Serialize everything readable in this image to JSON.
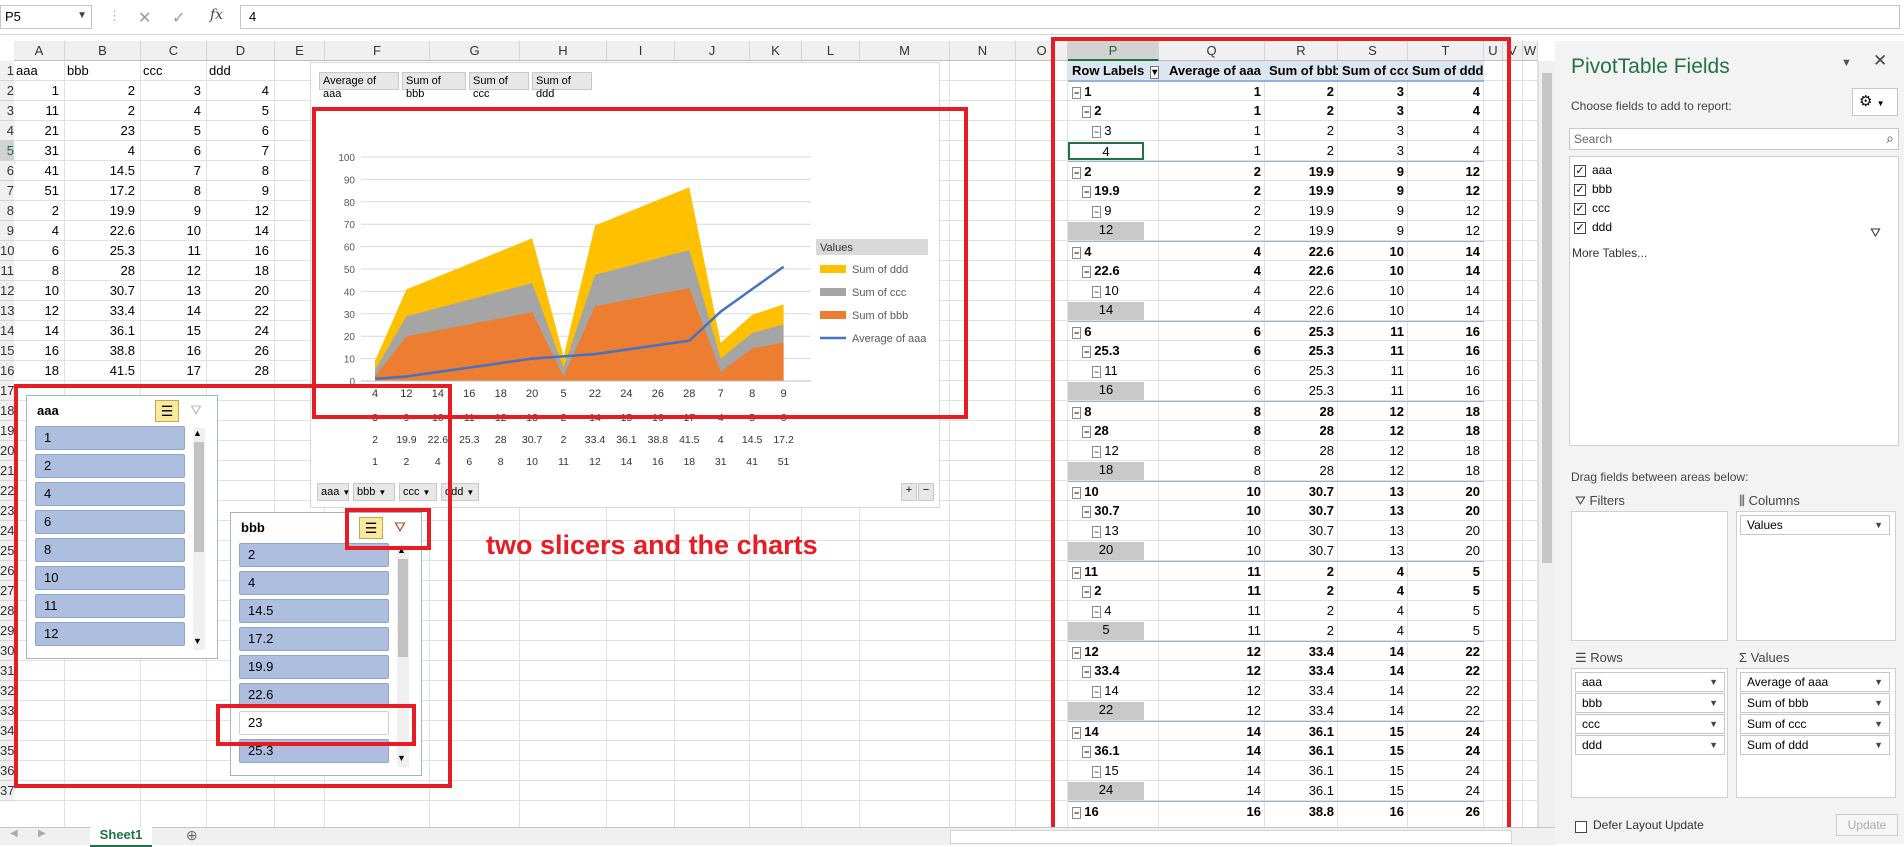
{
  "namebox": "P5",
  "formula": "4",
  "columns": [
    "A",
    "B",
    "C",
    "D",
    "E",
    "F",
    "G",
    "H",
    "I",
    "J",
    "K",
    "L",
    "M",
    "N",
    "O",
    "P",
    "Q",
    "R",
    "S",
    "T",
    "U",
    "V",
    "W"
  ],
  "row_numbers": [
    "1",
    "2",
    "3",
    "4",
    "5",
    "6",
    "7",
    "8",
    "9",
    "10",
    "11",
    "12",
    "13",
    "14",
    "15",
    "16",
    "17",
    "18",
    "19",
    "20",
    "21",
    "22",
    "23",
    "24",
    "25",
    "26",
    "27",
    "28",
    "29",
    "30",
    "31",
    "32",
    "33",
    "34",
    "35",
    "36",
    "37"
  ],
  "sheet": {
    "headers": [
      "aaa",
      "bbb",
      "ccc",
      "ddd"
    ],
    "rows": [
      [
        "1",
        "2",
        "3",
        "4"
      ],
      [
        "11",
        "2",
        "4",
        "5"
      ],
      [
        "21",
        "23",
        "5",
        "6"
      ],
      [
        "31",
        "4",
        "6",
        "7"
      ],
      [
        "41",
        "14.5",
        "7",
        "8"
      ],
      [
        "51",
        "17.2",
        "8",
        "9"
      ],
      [
        "2",
        "19.9",
        "9",
        "12"
      ],
      [
        "4",
        "22.6",
        "10",
        "14"
      ],
      [
        "6",
        "25.3",
        "11",
        "16"
      ],
      [
        "8",
        "28",
        "12",
        "18"
      ],
      [
        "10",
        "30.7",
        "13",
        "20"
      ],
      [
        "12",
        "33.4",
        "14",
        "22"
      ],
      [
        "14",
        "36.1",
        "15",
        "24"
      ],
      [
        "16",
        "38.8",
        "16",
        "26"
      ],
      [
        "18",
        "41.5",
        "17",
        "28"
      ]
    ]
  },
  "chart": {
    "value_buttons": [
      "Average of aaa",
      "Sum of bbb",
      "Sum of ccc",
      "Sum of ddd"
    ],
    "axis_buttons": [
      "aaa",
      "bbb",
      "ccc",
      "ddd"
    ],
    "legend_title": "Values",
    "table_rows": [
      [
        "3",
        "9",
        "10",
        "11",
        "12",
        "13",
        "2",
        "14",
        "15",
        "16",
        "17",
        "4",
        "5",
        "6"
      ],
      [
        "2",
        "19.9",
        "22.6",
        "25.3",
        "28",
        "30.7",
        "2",
        "33.4",
        "36.1",
        "38.8",
        "41.5",
        "4",
        "14.5",
        "17.2"
      ],
      [
        "1",
        "2",
        "4",
        "6",
        "8",
        "10",
        "11",
        "12",
        "14",
        "16",
        "18",
        "31",
        "41",
        "51"
      ]
    ]
  },
  "chart_data": {
    "type": "area",
    "categories": [
      "4",
      "12",
      "14",
      "16",
      "18",
      "20",
      "5",
      "22",
      "24",
      "26",
      "28",
      "7",
      "8",
      "9"
    ],
    "ylim": [
      0,
      100
    ],
    "yticks": [
      "0",
      "10",
      "20",
      "30",
      "40",
      "50",
      "60",
      "70",
      "80",
      "90",
      "100"
    ],
    "series": [
      {
        "name": "Sum of bbb",
        "kind": "area",
        "color": "#ed7d31",
        "values": [
          2,
          19.9,
          22.6,
          25.3,
          28,
          30.7,
          2,
          33.4,
          36.1,
          38.8,
          41.5,
          4,
          14.5,
          17.2
        ]
      },
      {
        "name": "Sum of ccc",
        "kind": "area",
        "color": "#a5a5a5",
        "values": [
          3,
          9,
          10,
          11,
          12,
          13,
          4,
          14,
          15,
          16,
          17,
          6,
          7,
          8
        ]
      },
      {
        "name": "Sum of ddd",
        "kind": "area",
        "color": "#ffc000",
        "values": [
          4,
          12,
          14,
          16,
          18,
          20,
          5,
          22,
          24,
          26,
          28,
          7,
          8,
          9
        ]
      },
      {
        "name": "Average of aaa",
        "kind": "line",
        "color": "#4472c4",
        "values": [
          1,
          2,
          4,
          6,
          8,
          10,
          11,
          12,
          14,
          16,
          18,
          31,
          41,
          51
        ]
      }
    ]
  },
  "slicer_aaa": {
    "title": "aaa",
    "items": [
      "1",
      "2",
      "4",
      "6",
      "8",
      "10",
      "11",
      "12"
    ]
  },
  "slicer_bbb": {
    "title": "bbb",
    "items": [
      "2",
      "4",
      "14.5",
      "17.2",
      "19.9",
      "22.6",
      "23",
      "25.3"
    ],
    "unselected": "23"
  },
  "annotation": "two slicers and the charts",
  "pivot": {
    "headers": [
      "Row Labels",
      "Average of aaa",
      "Sum of bbb",
      "Sum of ccc",
      "Sum of ddd"
    ],
    "rows": [
      {
        "l": "1",
        "lv": 0,
        "v": [
          "1",
          "2",
          "3",
          "4"
        ]
      },
      {
        "l": "2",
        "lv": 1,
        "v": [
          "1",
          "2",
          "3",
          "4"
        ]
      },
      {
        "l": "3",
        "lv": 2,
        "v": [
          "1",
          "2",
          "3",
          "4"
        ]
      },
      {
        "l": "4",
        "lv": 3,
        "v": [
          "1",
          "2",
          "3",
          "4"
        ]
      },
      {
        "l": "2",
        "lv": 0,
        "v": [
          "2",
          "19.9",
          "9",
          "12"
        ]
      },
      {
        "l": "19.9",
        "lv": 1,
        "v": [
          "2",
          "19.9",
          "9",
          "12"
        ]
      },
      {
        "l": "9",
        "lv": 2,
        "v": [
          "2",
          "19.9",
          "9",
          "12"
        ]
      },
      {
        "l": "12",
        "lv": 3,
        "v": [
          "2",
          "19.9",
          "9",
          "12"
        ]
      },
      {
        "l": "4",
        "lv": 0,
        "v": [
          "4",
          "22.6",
          "10",
          "14"
        ]
      },
      {
        "l": "22.6",
        "lv": 1,
        "v": [
          "4",
          "22.6",
          "10",
          "14"
        ]
      },
      {
        "l": "10",
        "lv": 2,
        "v": [
          "4",
          "22.6",
          "10",
          "14"
        ]
      },
      {
        "l": "14",
        "lv": 3,
        "v": [
          "4",
          "22.6",
          "10",
          "14"
        ]
      },
      {
        "l": "6",
        "lv": 0,
        "v": [
          "6",
          "25.3",
          "11",
          "16"
        ]
      },
      {
        "l": "25.3",
        "lv": 1,
        "v": [
          "6",
          "25.3",
          "11",
          "16"
        ]
      },
      {
        "l": "11",
        "lv": 2,
        "v": [
          "6",
          "25.3",
          "11",
          "16"
        ]
      },
      {
        "l": "16",
        "lv": 3,
        "v": [
          "6",
          "25.3",
          "11",
          "16"
        ]
      },
      {
        "l": "8",
        "lv": 0,
        "v": [
          "8",
          "28",
          "12",
          "18"
        ]
      },
      {
        "l": "28",
        "lv": 1,
        "v": [
          "8",
          "28",
          "12",
          "18"
        ]
      },
      {
        "l": "12",
        "lv": 2,
        "v": [
          "8",
          "28",
          "12",
          "18"
        ]
      },
      {
        "l": "18",
        "lv": 3,
        "v": [
          "8",
          "28",
          "12",
          "18"
        ]
      },
      {
        "l": "10",
        "lv": 0,
        "v": [
          "10",
          "30.7",
          "13",
          "20"
        ]
      },
      {
        "l": "30.7",
        "lv": 1,
        "v": [
          "10",
          "30.7",
          "13",
          "20"
        ]
      },
      {
        "l": "13",
        "lv": 2,
        "v": [
          "10",
          "30.7",
          "13",
          "20"
        ]
      },
      {
        "l": "20",
        "lv": 3,
        "v": [
          "10",
          "30.7",
          "13",
          "20"
        ]
      },
      {
        "l": "11",
        "lv": 0,
        "v": [
          "11",
          "2",
          "4",
          "5"
        ]
      },
      {
        "l": "2",
        "lv": 1,
        "v": [
          "11",
          "2",
          "4",
          "5"
        ]
      },
      {
        "l": "4",
        "lv": 2,
        "v": [
          "11",
          "2",
          "4",
          "5"
        ]
      },
      {
        "l": "5",
        "lv": 3,
        "v": [
          "11",
          "2",
          "4",
          "5"
        ]
      },
      {
        "l": "12",
        "lv": 0,
        "v": [
          "12",
          "33.4",
          "14",
          "22"
        ]
      },
      {
        "l": "33.4",
        "lv": 1,
        "v": [
          "12",
          "33.4",
          "14",
          "22"
        ]
      },
      {
        "l": "14",
        "lv": 2,
        "v": [
          "12",
          "33.4",
          "14",
          "22"
        ]
      },
      {
        "l": "22",
        "lv": 3,
        "v": [
          "12",
          "33.4",
          "14",
          "22"
        ]
      },
      {
        "l": "14",
        "lv": 0,
        "v": [
          "14",
          "36.1",
          "15",
          "24"
        ]
      },
      {
        "l": "36.1",
        "lv": 1,
        "v": [
          "14",
          "36.1",
          "15",
          "24"
        ]
      },
      {
        "l": "15",
        "lv": 2,
        "v": [
          "14",
          "36.1",
          "15",
          "24"
        ]
      },
      {
        "l": "24",
        "lv": 3,
        "v": [
          "14",
          "36.1",
          "15",
          "24"
        ]
      },
      {
        "l": "16",
        "lv": 0,
        "v": [
          "16",
          "38.8",
          "16",
          "26"
        ]
      }
    ]
  },
  "pane": {
    "title": "PivotTable Fields",
    "subtitle": "Choose fields to add to report:",
    "search_placeholder": "Search",
    "fields": [
      "aaa",
      "bbb",
      "ccc",
      "ddd"
    ],
    "more_tables": "More Tables...",
    "drag_hint": "Drag fields between areas below:",
    "filters_label": "Filters",
    "columns_label": "Columns",
    "rows_label": "Rows",
    "values_label": "Values",
    "columns_items": [
      "Values"
    ],
    "rows_items": [
      "aaa",
      "bbb",
      "ccc",
      "ddd"
    ],
    "values_items": [
      "Average of aaa",
      "Sum of bbb",
      "Sum of ccc",
      "Sum of ddd"
    ],
    "defer_label": "Defer Layout Update",
    "update_label": "Update"
  },
  "tabs": {
    "sheet_name": "Sheet1"
  }
}
